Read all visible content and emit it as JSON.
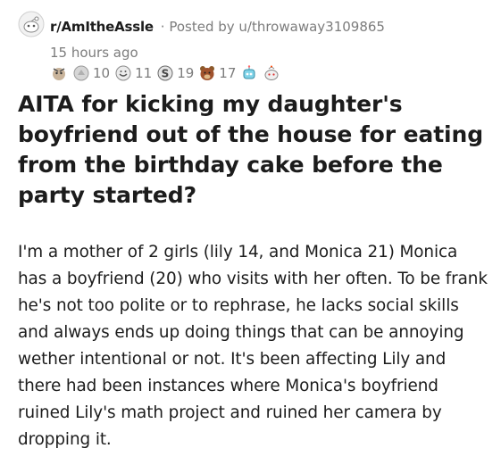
{
  "post": {
    "subreddit": "r/AmItheAss",
    "subreddit_tail": "le",
    "separator": "·",
    "posted_by": "Posted by u/throwaway3109865",
    "time_ago": "15 hours ago",
    "awards": [
      {
        "icon": "helpful-award-icon",
        "count": ""
      },
      {
        "icon": "silver-award-icon",
        "count": "10"
      },
      {
        "icon": "wholesome-award-icon",
        "count": "11"
      },
      {
        "icon": "snek-award-icon",
        "count": "19"
      },
      {
        "icon": "bear-award-icon",
        "count": "17"
      },
      {
        "icon": "robot-award-icon",
        "count": ""
      },
      {
        "icon": "cake-award-icon",
        "count": ""
      }
    ],
    "title": "AITA for kicking my daughter's boyfriend out of the house for eating from the birthday cake before the party started?",
    "body": "I'm a mother of 2 girls (lily 14, and Monica 21) Monica has a boyfriend (20) who visits with her often. To be frank he's not too polite or to rephrase, he lacks social skills and always ends up doing things that can be annoying wether intentional or not. It's been affecting Lily and there had been instances where Monica's boyfriend ruined Lily's math project and ruined her camera by dropping it."
  },
  "colors": {
    "text": "#1c1c1c",
    "meta": "#7c7c7c",
    "background": "#ffffff"
  }
}
